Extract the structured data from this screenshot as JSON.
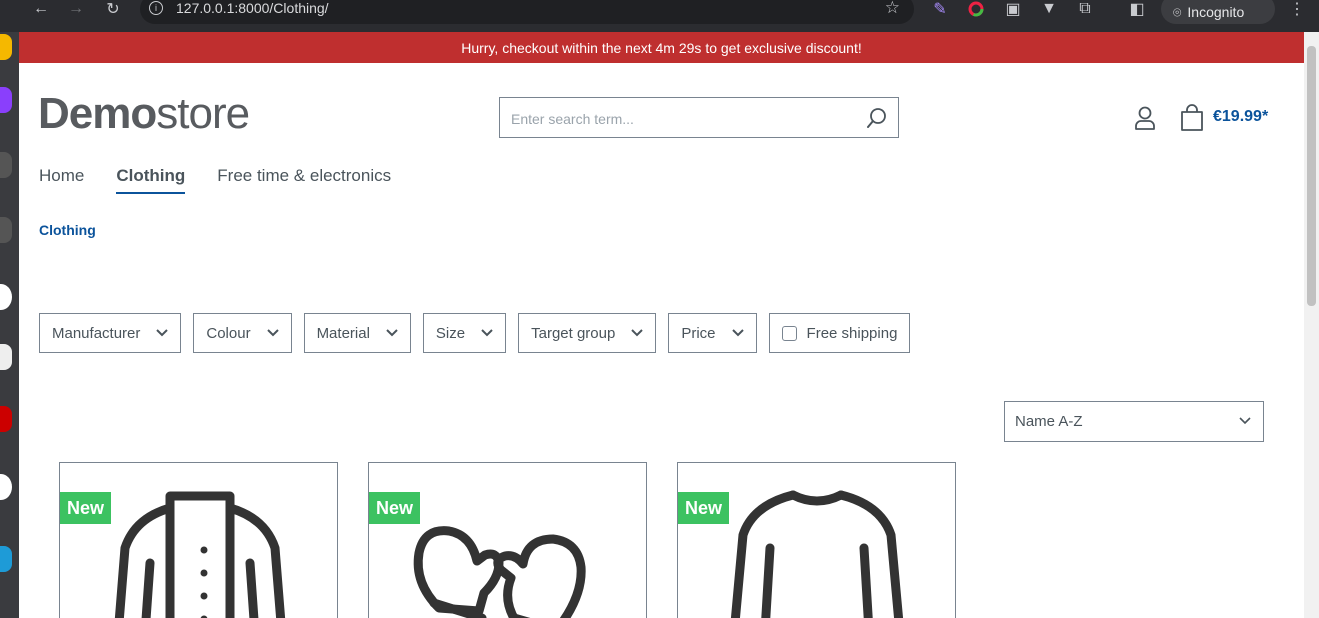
{
  "browser": {
    "url": "127.0.0.1:8000/Clothing/",
    "incognito_label": "Incognito"
  },
  "banner": {
    "text": "Hurry, checkout within the next 4m 29s to get exclusive discount!",
    "bg_color": "#bf2f2f"
  },
  "header": {
    "logo_bold": "Demo",
    "logo_light": "store",
    "search_placeholder": "Enter search term...",
    "cart_total": "€19.99*",
    "accent_color": "#0b539b"
  },
  "nav": {
    "items": [
      {
        "label": "Home"
      },
      {
        "label": "Clothing",
        "active": true
      },
      {
        "label": "Free time & electronics"
      }
    ]
  },
  "breadcrumb": "Clothing",
  "filters": {
    "items": [
      {
        "label": "Manufacturer"
      },
      {
        "label": "Colour"
      },
      {
        "label": "Material"
      },
      {
        "label": "Size"
      },
      {
        "label": "Target group"
      },
      {
        "label": "Price"
      }
    ],
    "free_shipping_label": "Free shipping"
  },
  "sort": {
    "selected": "Name A-Z"
  },
  "products": [
    {
      "badge": "New",
      "icon": "jacket-icon"
    },
    {
      "badge": "New",
      "icon": "mittens-icon"
    },
    {
      "badge": "New",
      "icon": "sweater-icon"
    }
  ],
  "badge_color": "#3cc261"
}
